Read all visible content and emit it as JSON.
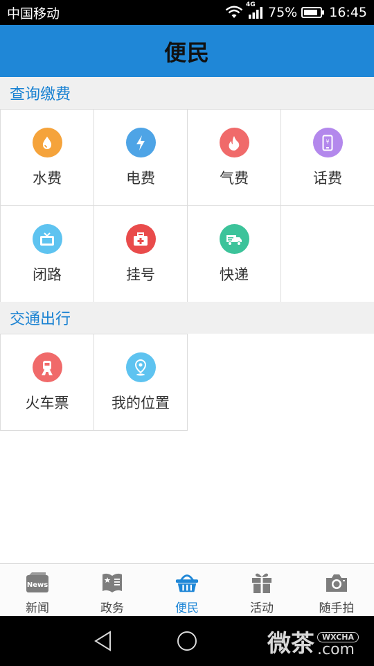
{
  "status_bar": {
    "carrier": "中国移动",
    "network": "4G",
    "battery": "75%",
    "time": "16:45"
  },
  "header": {
    "title": "便民"
  },
  "sections": [
    {
      "title": "查询缴费",
      "items": [
        {
          "label": "水费",
          "icon": "water-drop-icon",
          "color": "#f5a33b"
        },
        {
          "label": "电费",
          "icon": "lightning-icon",
          "color": "#4ea4e6"
        },
        {
          "label": "气费",
          "icon": "flame-icon",
          "color": "#f06a6a"
        },
        {
          "label": "话费",
          "icon": "phone-icon",
          "color": "#b388ec"
        },
        {
          "label": "闭路",
          "icon": "tv-icon",
          "color": "#5ec3f0"
        },
        {
          "label": "挂号",
          "icon": "medical-kit-icon",
          "color": "#e94b4b"
        },
        {
          "label": "快递",
          "icon": "delivery-truck-icon",
          "color": "#3cc39a"
        }
      ]
    },
    {
      "title": "交通出行",
      "items": [
        {
          "label": "火车票",
          "icon": "train-icon",
          "color": "#f06a6a"
        },
        {
          "label": "我的位置",
          "icon": "location-pin-icon",
          "color": "#5ec3f0"
        }
      ]
    }
  ],
  "tabs": [
    {
      "label": "新闻",
      "icon": "news-icon",
      "active": false,
      "badge_text": "News"
    },
    {
      "label": "政务",
      "icon": "government-icon",
      "active": false
    },
    {
      "label": "便民",
      "icon": "basket-icon",
      "active": true
    },
    {
      "label": "活动",
      "icon": "gift-icon",
      "active": false
    },
    {
      "label": "随手拍",
      "icon": "camera-icon",
      "active": false
    }
  ],
  "watermark": {
    "main": "微茶",
    "badge": "WXCHA",
    "domain": ".com"
  },
  "colors": {
    "accent": "#1f87d7",
    "section_text": "#1a82d2"
  }
}
